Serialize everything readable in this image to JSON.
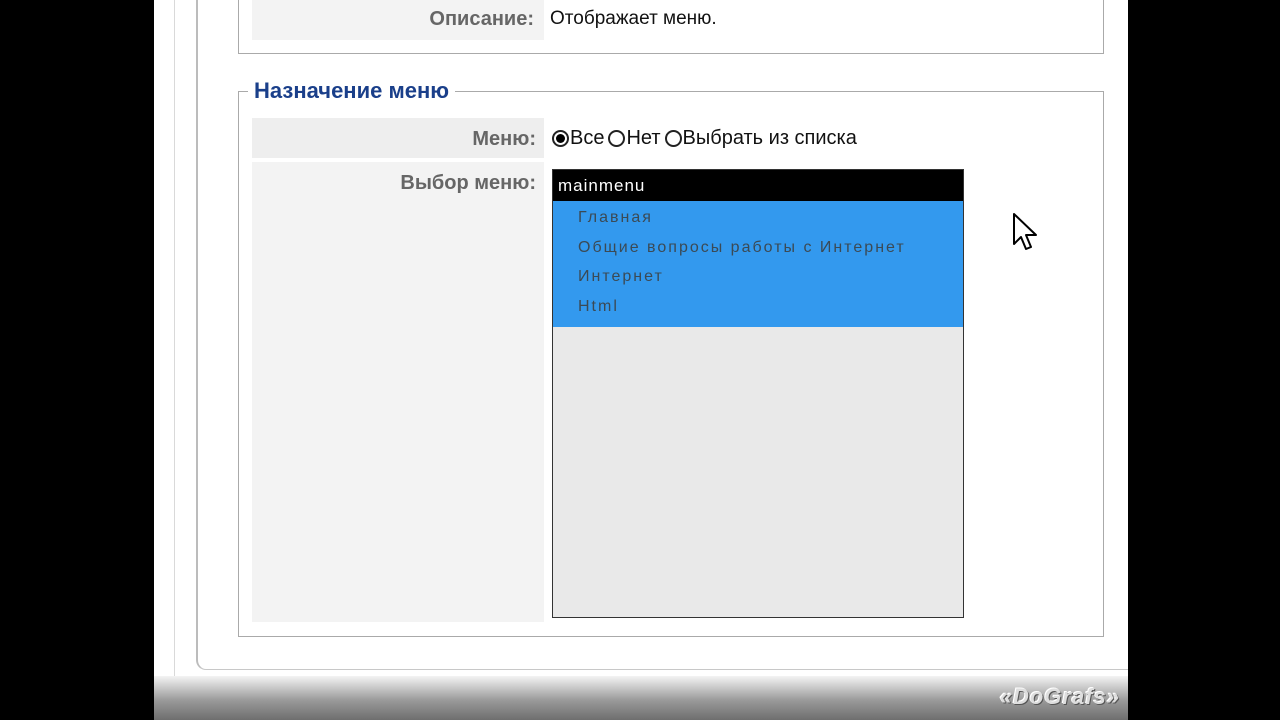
{
  "description_row": {
    "label": "Описание:",
    "value": "Отображает меню."
  },
  "menu_assignment": {
    "legend": "Назначение меню",
    "menu_label": "Меню:",
    "radio_options": [
      {
        "label": "Все",
        "checked": true
      },
      {
        "label": "Нет",
        "checked": false
      },
      {
        "label": "Выбрать из списка",
        "checked": false
      }
    ],
    "choose_label": "Выбор меню:",
    "listbox": {
      "group": "mainmenu",
      "items": [
        "Главная",
        "Общие вопросы работы с Интернет",
        "Интернет",
        "Html"
      ],
      "selection_color": "#3399ee"
    }
  },
  "watermark": "«DoGrafs»"
}
